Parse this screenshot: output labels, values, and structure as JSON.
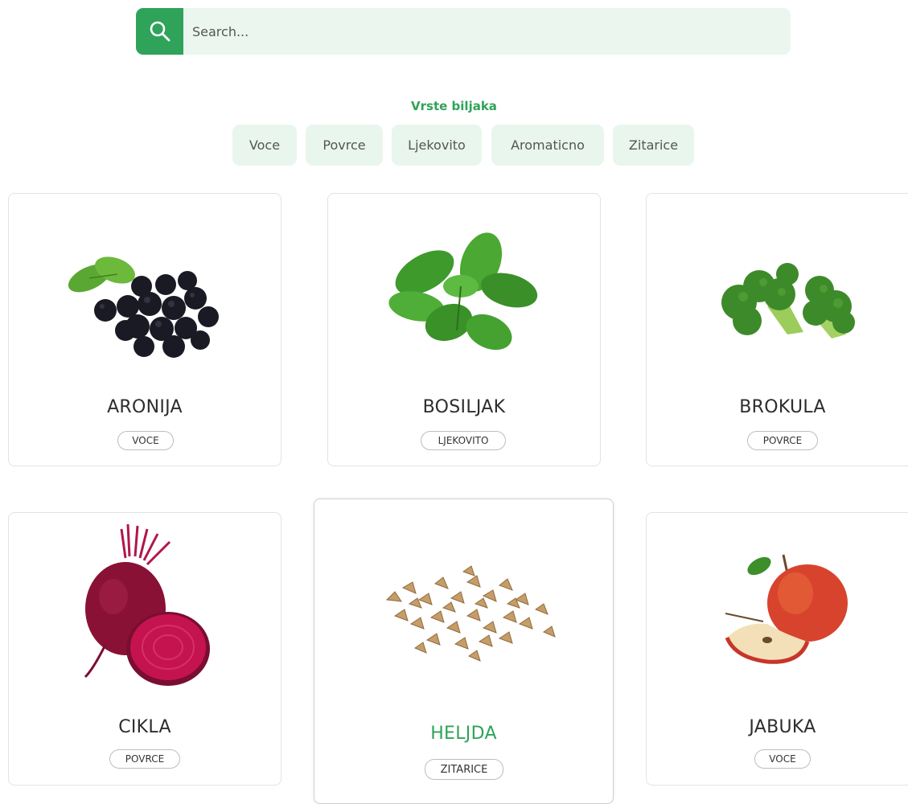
{
  "search": {
    "placeholder": "Search..."
  },
  "filters": {
    "title": "Vrste biljaka",
    "items": [
      "Voce",
      "Povrce",
      "Ljekovito",
      "Aromaticno",
      "Zitarice"
    ]
  },
  "plants": [
    {
      "name": "ARONIJA",
      "category": "VOCE",
      "image": "aronia-berries"
    },
    {
      "name": "BOSILJAK",
      "category": "LJEKOVITO",
      "image": "basil-leaves"
    },
    {
      "name": "BROKULA",
      "category": "POVRCE",
      "image": "broccoli"
    },
    {
      "name": "CIKLA",
      "category": "POVRCE",
      "image": "beetroot"
    },
    {
      "name": "HELJDA",
      "category": "ZITARICE",
      "image": "buckwheat"
    },
    {
      "name": "JABUKA",
      "category": "VOCE",
      "image": "apple"
    }
  ],
  "colors": {
    "accent": "#2fa35a",
    "chip_bg": "#e9f6ed",
    "search_bg": "#eaf6ee"
  }
}
